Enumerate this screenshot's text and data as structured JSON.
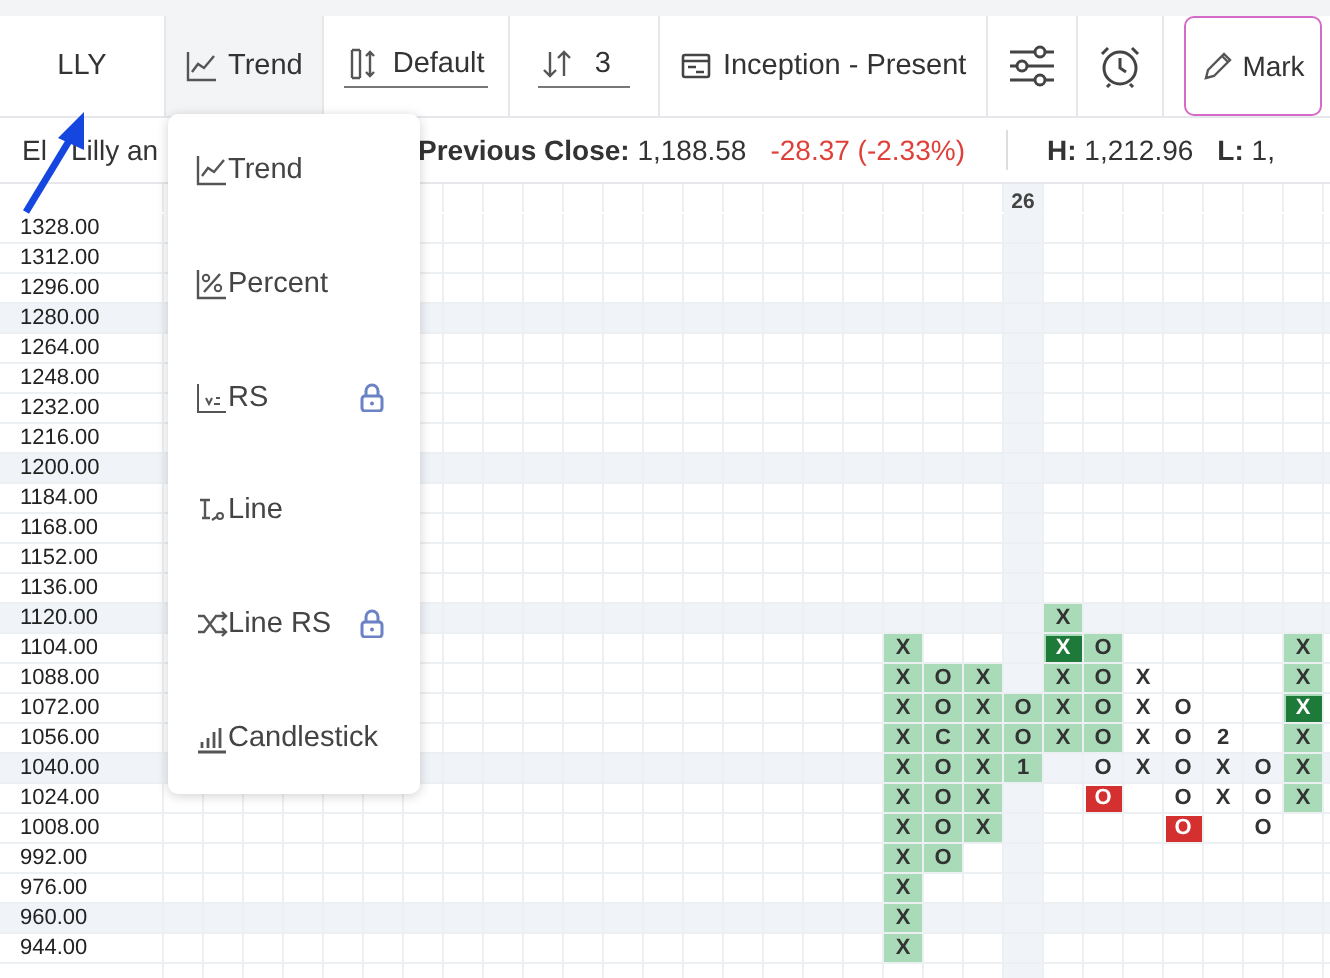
{
  "toolbar": {
    "symbol": "LLY",
    "chart_type": {
      "label": "Trend",
      "expanded": true
    },
    "scale": "Default",
    "box_size": "3",
    "range": "Inception - Present",
    "mark_button": "Mark"
  },
  "info": {
    "name_parts": [
      "El",
      "Lilly an"
    ],
    "previous_close": "**Previous Close:** 1,188.58",
    "change": "-28.37 (-2.33%)",
    "high": "**H:** 1,212.96",
    "low": "**L:** 1,"
  },
  "chart_type_menu": [
    {
      "label": "Trend",
      "kind": "trend",
      "locked": false
    },
    {
      "label": "Percent",
      "kind": "percent",
      "locked": false
    },
    {
      "label": "RS",
      "kind": "rs",
      "locked": true
    },
    {
      "label": "Line",
      "kind": "line",
      "locked": false
    },
    {
      "label": "Line RS",
      "kind": "line-rs",
      "locked": true
    },
    {
      "label": "Candlestick",
      "kind": "candlestick",
      "locked": false
    }
  ],
  "chart": {
    "y_labels": [
      {
        "label": "1328.00",
        "band": false
      },
      {
        "label": "1312.00",
        "band": false
      },
      {
        "label": "1296.00",
        "band": false
      },
      {
        "label": "1280.00",
        "band": true
      },
      {
        "label": "1264.00",
        "band": false
      },
      {
        "label": "1248.00",
        "band": false
      },
      {
        "label": "1232.00",
        "band": false
      },
      {
        "label": "1216.00",
        "band": false
      },
      {
        "label": "1200.00",
        "band": true
      },
      {
        "label": "1184.00",
        "band": false
      },
      {
        "label": "1168.00",
        "band": false
      },
      {
        "label": "1152.00",
        "band": false
      },
      {
        "label": "1136.00",
        "band": false
      },
      {
        "label": "1120.00",
        "band": true
      },
      {
        "label": "1104.00",
        "band": false
      },
      {
        "label": "1088.00",
        "band": false
      },
      {
        "label": "1072.00",
        "band": false
      },
      {
        "label": "1056.00",
        "band": false
      },
      {
        "label": "1040.00",
        "band": true
      },
      {
        "label": "1024.00",
        "band": false
      },
      {
        "label": "1008.00",
        "band": false
      },
      {
        "label": "992.00",
        "band": false
      },
      {
        "label": "976.00",
        "band": false
      },
      {
        "label": "960.00",
        "band": true
      },
      {
        "label": "944.00",
        "band": false
      }
    ],
    "columns": [
      {
        "cells": [
          null,
          null,
          null,
          null,
          null,
          null,
          null,
          null,
          null,
          null,
          null,
          null,
          null,
          null,
          {
            "mark": "X",
            "shaded": true,
            "kind": "plain"
          },
          {
            "mark": "X",
            "shaded": true,
            "kind": "plain"
          },
          {
            "mark": "X",
            "shaded": true,
            "kind": "plain"
          },
          {
            "mark": "X",
            "shaded": true,
            "kind": "plain"
          },
          {
            "mark": "X",
            "shaded": true,
            "kind": "plain"
          },
          {
            "mark": "X",
            "shaded": true,
            "kind": "plain"
          },
          {
            "mark": "X",
            "shaded": true,
            "kind": "plain"
          },
          {
            "mark": "X",
            "shaded": true,
            "kind": "plain"
          },
          {
            "mark": "X",
            "shaded": true,
            "kind": "plain"
          },
          {
            "mark": "X",
            "shaded": true,
            "kind": "plain"
          },
          {
            "mark": "X",
            "shaded": true,
            "kind": "plain"
          }
        ]
      },
      {
        "cells": [
          null,
          null,
          null,
          null,
          null,
          null,
          null,
          null,
          null,
          null,
          null,
          null,
          null,
          null,
          null,
          {
            "mark": "O",
            "shaded": true,
            "kind": "plain"
          },
          {
            "mark": "O",
            "shaded": true,
            "kind": "plain"
          },
          {
            "mark": "C",
            "shaded": true,
            "kind": "plain"
          },
          {
            "mark": "O",
            "shaded": true,
            "kind": "plain"
          },
          {
            "mark": "O",
            "shaded": true,
            "kind": "plain"
          },
          {
            "mark": "O",
            "shaded": true,
            "kind": "plain"
          },
          {
            "mark": "O",
            "shaded": true,
            "kind": "plain"
          }
        ]
      },
      {
        "cells": [
          null,
          null,
          null,
          null,
          null,
          null,
          null,
          null,
          null,
          null,
          null,
          null,
          null,
          null,
          null,
          {
            "mark": "X",
            "shaded": true,
            "kind": "plain"
          },
          {
            "mark": "X",
            "shaded": true,
            "kind": "plain"
          },
          {
            "mark": "X",
            "shaded": true,
            "kind": "plain"
          },
          {
            "mark": "X",
            "shaded": true,
            "kind": "plain"
          },
          {
            "mark": "X",
            "shaded": true,
            "kind": "plain"
          },
          {
            "mark": "X",
            "shaded": true,
            "kind": "plain"
          }
        ]
      },
      {
        "label": "26",
        "cells": [
          null,
          null,
          null,
          null,
          null,
          null,
          null,
          null,
          null,
          null,
          null,
          null,
          null,
          null,
          null,
          null,
          {
            "mark": "O",
            "shaded": true,
            "kind": "plain"
          },
          {
            "mark": "O",
            "shaded": true,
            "kind": "plain"
          },
          {
            "mark": "1",
            "shaded": true,
            "kind": "plain"
          }
        ]
      },
      {
        "cells": [
          null,
          null,
          null,
          null,
          null,
          null,
          null,
          null,
          null,
          null,
          null,
          null,
          null,
          {
            "mark": "X",
            "shaded": true,
            "kind": "plain"
          },
          {
            "mark": "X",
            "shaded": true,
            "kind": "signal-up"
          },
          {
            "mark": "X",
            "shaded": true,
            "kind": "plain"
          },
          {
            "mark": "X",
            "shaded": true,
            "kind": "plain"
          },
          {
            "mark": "X",
            "shaded": true,
            "kind": "plain"
          }
        ]
      },
      {
        "cells": [
          null,
          null,
          null,
          null,
          null,
          null,
          null,
          null,
          null,
          null,
          null,
          null,
          null,
          null,
          {
            "mark": "O",
            "shaded": true,
            "kind": "plain"
          },
          {
            "mark": "O",
            "shaded": true,
            "kind": "plain"
          },
          {
            "mark": "O",
            "shaded": true,
            "kind": "plain"
          },
          {
            "mark": "O",
            "shaded": true,
            "kind": "plain"
          },
          {
            "mark": "O",
            "shaded": false,
            "kind": "plain"
          },
          {
            "mark": "O",
            "shaded": false,
            "kind": "signal-down"
          }
        ]
      },
      {
        "cells": [
          null,
          null,
          null,
          null,
          null,
          null,
          null,
          null,
          null,
          null,
          null,
          null,
          null,
          null,
          null,
          {
            "mark": "X",
            "shaded": false,
            "kind": "plain"
          },
          {
            "mark": "X",
            "shaded": false,
            "kind": "plain"
          },
          {
            "mark": "X",
            "shaded": false,
            "kind": "plain"
          },
          {
            "mark": "X",
            "shaded": false,
            "kind": "plain"
          }
        ]
      },
      {
        "cells": [
          null,
          null,
          null,
          null,
          null,
          null,
          null,
          null,
          null,
          null,
          null,
          null,
          null,
          null,
          null,
          null,
          {
            "mark": "O",
            "shaded": false,
            "kind": "plain"
          },
          {
            "mark": "O",
            "shaded": false,
            "kind": "plain"
          },
          {
            "mark": "O",
            "shaded": false,
            "kind": "plain"
          },
          {
            "mark": "O",
            "shaded": false,
            "kind": "plain"
          },
          {
            "mark": "O",
            "shaded": false,
            "kind": "signal-down"
          }
        ]
      },
      {
        "cells": [
          null,
          null,
          null,
          null,
          null,
          null,
          null,
          null,
          null,
          null,
          null,
          null,
          null,
          null,
          null,
          null,
          null,
          {
            "mark": "2",
            "shaded": false,
            "kind": "plain"
          },
          {
            "mark": "X",
            "shaded": false,
            "kind": "plain"
          },
          {
            "mark": "X",
            "shaded": false,
            "kind": "plain"
          }
        ]
      },
      {
        "cells": [
          null,
          null,
          null,
          null,
          null,
          null,
          null,
          null,
          null,
          null,
          null,
          null,
          null,
          null,
          null,
          null,
          null,
          null,
          {
            "mark": "O",
            "shaded": false,
            "kind": "plain"
          },
          {
            "mark": "O",
            "shaded": false,
            "kind": "plain"
          },
          {
            "mark": "O",
            "shaded": false,
            "kind": "plain"
          }
        ]
      },
      {
        "cells": [
          null,
          null,
          null,
          null,
          null,
          null,
          null,
          null,
          null,
          null,
          null,
          null,
          null,
          null,
          {
            "mark": "X",
            "shaded": true,
            "kind": "plain"
          },
          {
            "mark": "X",
            "shaded": true,
            "kind": "plain"
          },
          {
            "mark": "X",
            "shaded": true,
            "kind": "signal-up"
          },
          {
            "mark": "X",
            "shaded": true,
            "kind": "plain"
          },
          {
            "mark": "X",
            "shaded": true,
            "kind": "plain"
          },
          {
            "mark": "X",
            "shaded": true,
            "kind": "plain"
          }
        ]
      }
    ]
  }
}
